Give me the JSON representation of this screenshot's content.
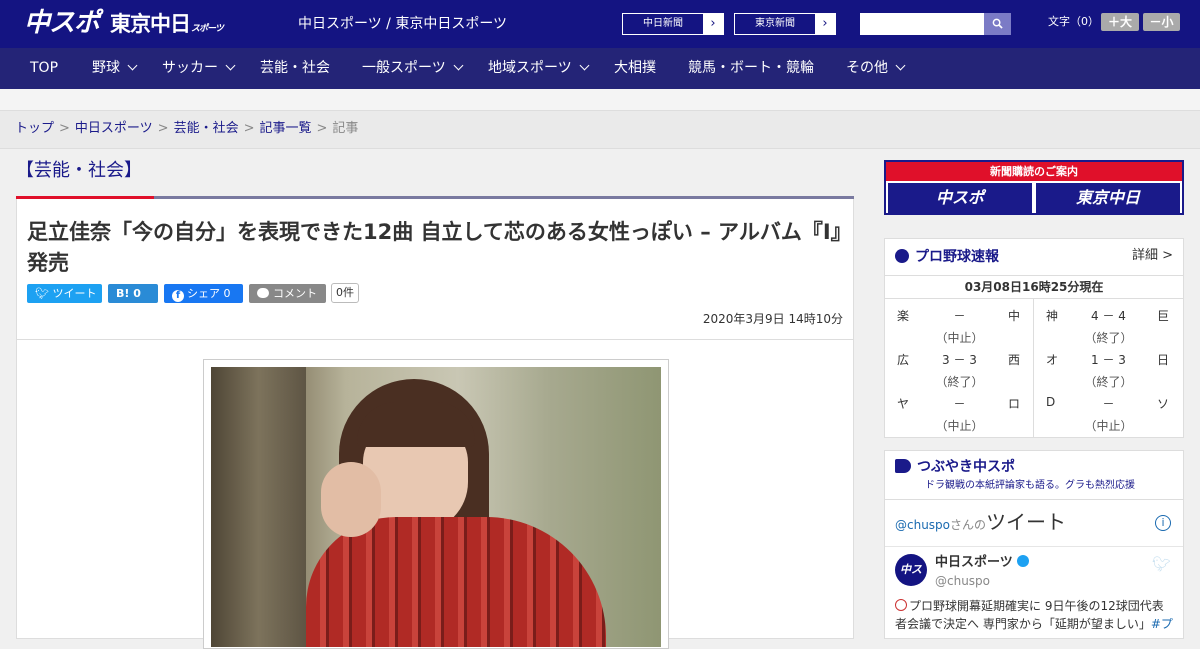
{
  "header": {
    "logo_main": "中スポ",
    "logo_tokyo": "東京中日",
    "logo_tokyo_small": "スポーツ",
    "site_name": "中日スポーツ / 東京中日スポーツ",
    "link_chunichi": "中日新聞",
    "link_tokyo": "東京新聞",
    "search_placeholder": "",
    "font_label": "文字（0）",
    "font_bigger": "＋大",
    "font_smaller": "－小"
  },
  "nav": {
    "items": [
      {
        "label": "TOP"
      },
      {
        "label": "野球"
      },
      {
        "label": "サッカー"
      },
      {
        "label": "芸能・社会"
      },
      {
        "label": "一般スポーツ"
      },
      {
        "label": "地域スポーツ"
      },
      {
        "label": "大相撲"
      },
      {
        "label": "競馬・ボート・競輪"
      },
      {
        "label": "その他"
      }
    ]
  },
  "breadcrumb": {
    "items": [
      "トップ",
      "中日スポーツ",
      "芸能・社会",
      "記事一覧",
      "記事"
    ],
    "separator": ">"
  },
  "article": {
    "section": "【芸能・社会】",
    "headline": "足立佳奈「今の自分」を表現できた12曲 自立して芯のある女性っぽい – アルバム『I』発売",
    "share": {
      "tweet": "ツイート",
      "hatena": "B! 0",
      "facebook": "シェア 0",
      "comment": "コメント",
      "comment_count": "0件"
    },
    "date": "2020年3月9日 14時10分"
  },
  "sidebar": {
    "ad": {
      "title": "新聞購読のご案内",
      "logo1": "中スポ",
      "logo2": "東京中日"
    },
    "baseball": {
      "title": "プロ野球速報",
      "more": "詳細 >",
      "timestamp": "03月08日16時25分現在",
      "games": [
        {
          "home": "楽",
          "score": "－",
          "away": "中",
          "status": "（中止）"
        },
        {
          "home": "広",
          "score": "3 － 3",
          "away": "西",
          "status": "（終了）"
        },
        {
          "home": "ヤ",
          "score": "－",
          "away": "ロ",
          "status": "（中止）"
        },
        {
          "home": "神",
          "score": "4 － 4",
          "away": "巨",
          "status": "（終了）"
        },
        {
          "home": "オ",
          "score": "1 － 3",
          "away": "日",
          "status": "（終了）"
        },
        {
          "home": "D",
          "score": "－",
          "away": "ソ",
          "status": "（中止）"
        }
      ]
    },
    "tsubuyaki": {
      "title": "つぶやき中スポ",
      "subtitle": "ドラ観戦の本紙評論家も語る。グラも熱烈応援"
    },
    "twitter": {
      "handle_link": "@chuspo",
      "suffix": "さんの",
      "big": "ツイート",
      "name": "中日スポーツ",
      "handle": "@chuspo",
      "avatar": "中スポ",
      "text": "プロ野球開幕延期確実に 9日午後の12球団代表者会議で決定へ 専門家から「延期が望ましい」",
      "hashtag": "#プ"
    }
  }
}
